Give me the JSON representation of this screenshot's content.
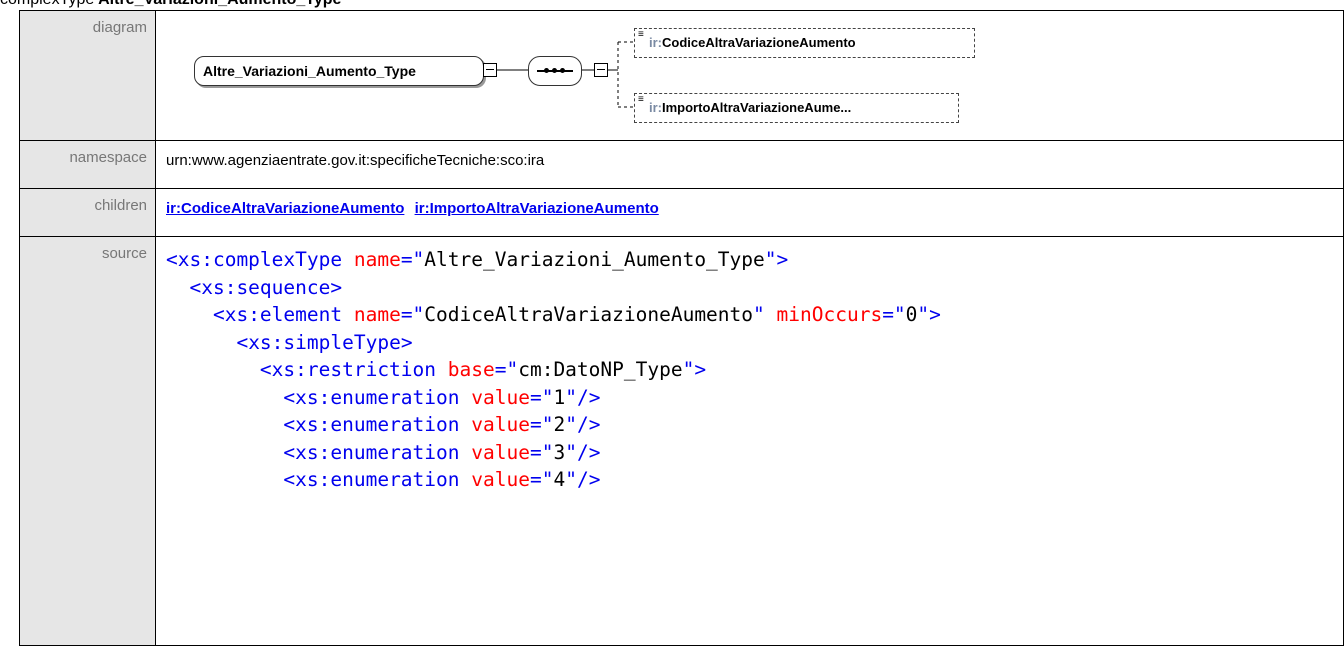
{
  "heading": {
    "prefix": "complexType",
    "name": "Altre_Variazioni_Aumento_Type"
  },
  "rows": {
    "diagram_label": "diagram",
    "namespace_label": "namespace",
    "namespace_value": "urn:www.agenziaentrate.gov.it:specificheTecniche:sco:ira",
    "children_label": "children",
    "children": [
      "ir:CodiceAltraVariazioneAumento",
      "ir:ImportoAltraVariazioneAumento"
    ],
    "source_label": "source"
  },
  "diagram": {
    "type_name": "Altre_Variazioni_Aumento_Type",
    "elements": [
      {
        "prefix": "ir:",
        "name": "CodiceAltraVariazioneAumento"
      },
      {
        "prefix": "ir:",
        "name": "ImportoAltraVariazioneAume..."
      }
    ]
  },
  "source_lines": [
    {
      "indent": "",
      "tag": "<xs:complexType",
      "attrs": [
        {
          "n": " name",
          "v": "Altre_Variazioni_Aumento_Type"
        }
      ],
      "end": ">"
    },
    {
      "indent": "  ",
      "tag": "<xs:sequence",
      "attrs": [],
      "end": ">"
    },
    {
      "indent": "    ",
      "tag": "<xs:element",
      "attrs": [
        {
          "n": " name",
          "v": "CodiceAltraVariazioneAumento"
        },
        {
          "n": " minOccurs",
          "v": "0"
        }
      ],
      "end": ">"
    },
    {
      "indent": "      ",
      "tag": "<xs:simpleType",
      "attrs": [],
      "end": ">"
    },
    {
      "indent": "        ",
      "tag": "<xs:restriction",
      "attrs": [
        {
          "n": " base",
          "v": "cm:DatoNP_Type"
        }
      ],
      "end": ">"
    },
    {
      "indent": "          ",
      "tag": "<xs:enumeration",
      "attrs": [
        {
          "n": " value",
          "v": "1"
        }
      ],
      "end": "/>"
    },
    {
      "indent": "          ",
      "tag": "<xs:enumeration",
      "attrs": [
        {
          "n": " value",
          "v": "2"
        }
      ],
      "end": "/>"
    },
    {
      "indent": "          ",
      "tag": "<xs:enumeration",
      "attrs": [
        {
          "n": " value",
          "v": "3"
        }
      ],
      "end": "/>"
    },
    {
      "indent": "          ",
      "tag": "<xs:enumeration",
      "attrs": [
        {
          "n": " value",
          "v": "4"
        }
      ],
      "end": "/>"
    }
  ]
}
